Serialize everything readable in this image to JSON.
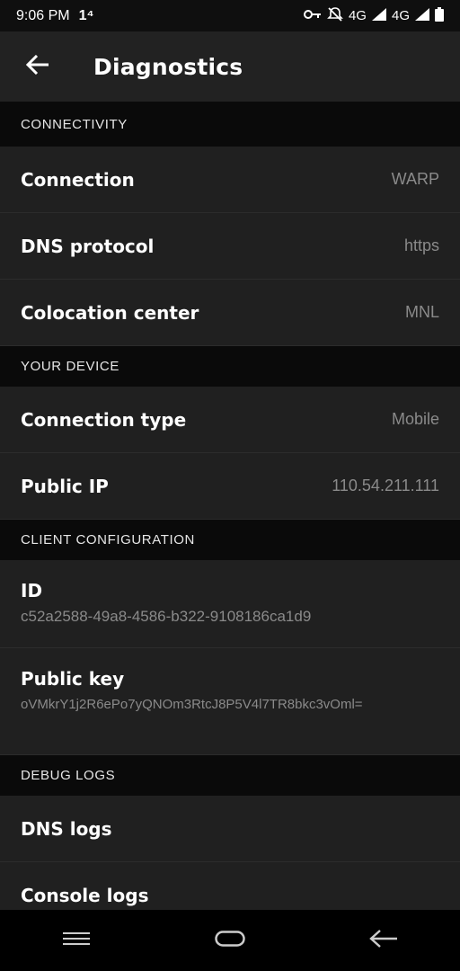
{
  "status": {
    "time": "9:06 PM",
    "notif": "1⁴",
    "net1": "4G",
    "net1_small": "4G",
    "net2": "4G"
  },
  "appbar": {
    "title": "Diagnostics"
  },
  "sections": {
    "connectivity": {
      "header": "CONNECTIVITY",
      "connection": {
        "label": "Connection",
        "value": "WARP"
      },
      "dns": {
        "label": "DNS protocol",
        "value": "https"
      },
      "colo": {
        "label": "Colocation center",
        "value": "MNL"
      }
    },
    "device": {
      "header": "YOUR DEVICE",
      "conn_type": {
        "label": "Connection type",
        "value": "Mobile"
      },
      "public_ip": {
        "label": "Public IP",
        "value": "110.54.211.111"
      }
    },
    "client": {
      "header": "CLIENT CONFIGURATION",
      "id": {
        "label": "ID",
        "value": "c52a2588-49a8-4586-b322-9108186ca1d9"
      },
      "public_key": {
        "label": "Public key",
        "value": "oVMkrY1j2R6ePo7yQNOm3RtcJ8P5V4l7TR8bkc3vOml="
      }
    },
    "debug": {
      "header": "DEBUG LOGS",
      "dns_logs": {
        "label": "DNS logs"
      },
      "console_logs": {
        "label": "Console logs"
      }
    }
  },
  "icons": {
    "back": "arrow-left-icon",
    "vpn_key": "key-icon",
    "mute": "bell-off-icon",
    "signal": "signal-icon",
    "battery": "battery-icon"
  }
}
